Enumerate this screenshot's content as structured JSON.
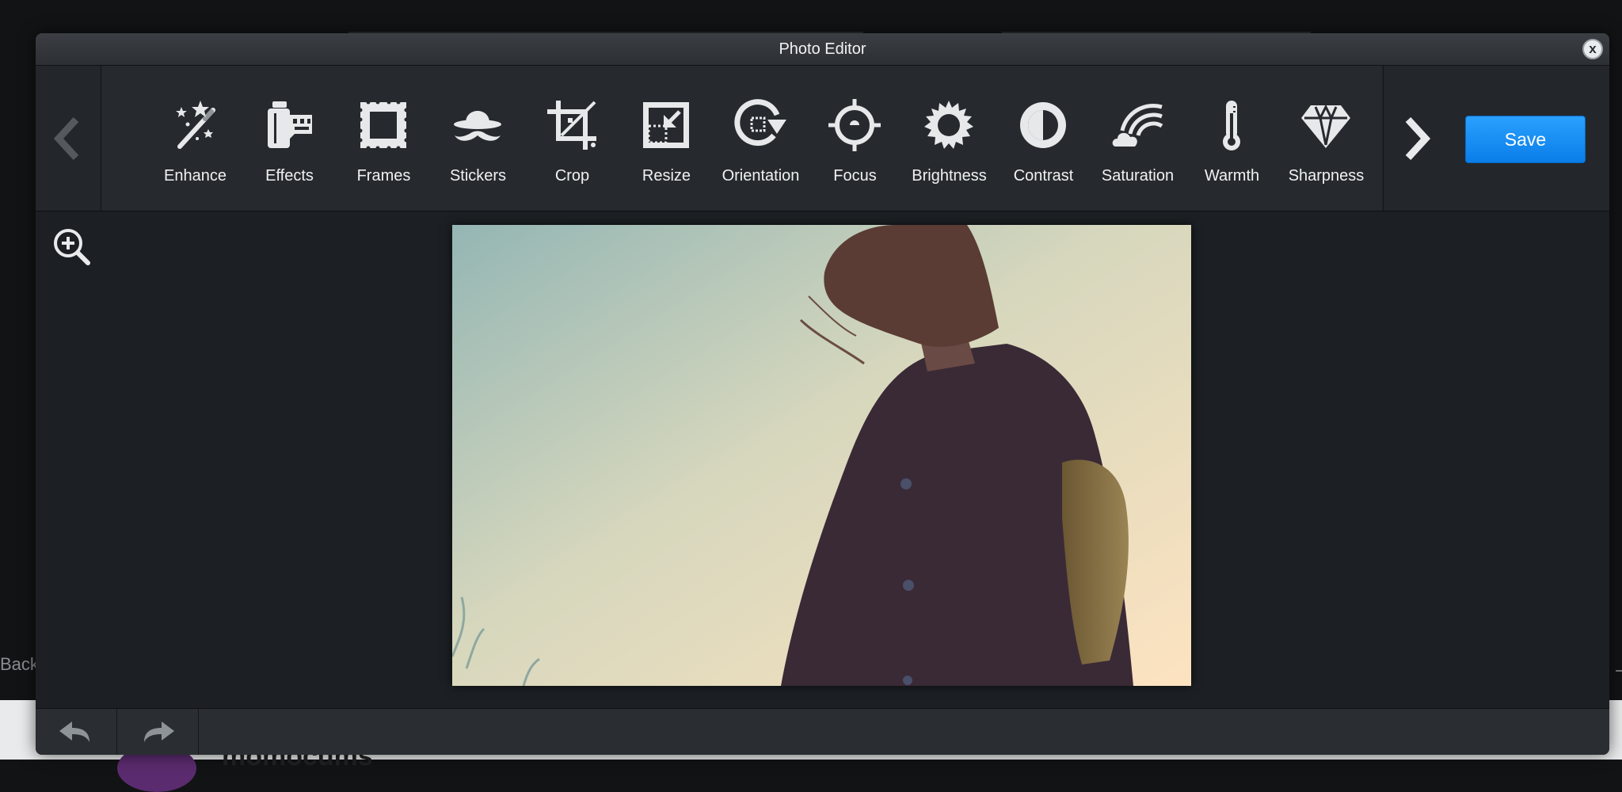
{
  "window": {
    "title": "Photo Editor",
    "close_label": "x"
  },
  "background": {
    "back_label": "Back",
    "username": "momocums"
  },
  "toolbar": {
    "tools": [
      {
        "label": "Enhance",
        "icon": "magic-wand-icon"
      },
      {
        "label": "Effects",
        "icon": "film-roll-icon"
      },
      {
        "label": "Frames",
        "icon": "frame-icon"
      },
      {
        "label": "Stickers",
        "icon": "hat-mustache-icon"
      },
      {
        "label": "Crop",
        "icon": "crop-icon"
      },
      {
        "label": "Resize",
        "icon": "resize-icon"
      },
      {
        "label": "Orientation",
        "icon": "rotate-icon"
      },
      {
        "label": "Focus",
        "icon": "focus-target-icon"
      },
      {
        "label": "Brightness",
        "icon": "sun-icon"
      },
      {
        "label": "Contrast",
        "icon": "contrast-icon"
      },
      {
        "label": "Saturation",
        "icon": "rainbow-cloud-icon"
      },
      {
        "label": "Warmth",
        "icon": "thermometer-icon"
      },
      {
        "label": "Sharpness",
        "icon": "diamond-icon"
      }
    ],
    "save_label": "Save"
  },
  "colors": {
    "accent": "#1a8ff5",
    "panel": "#23272b",
    "canvas": "#1c2024",
    "icon": "#e6e8ea"
  }
}
